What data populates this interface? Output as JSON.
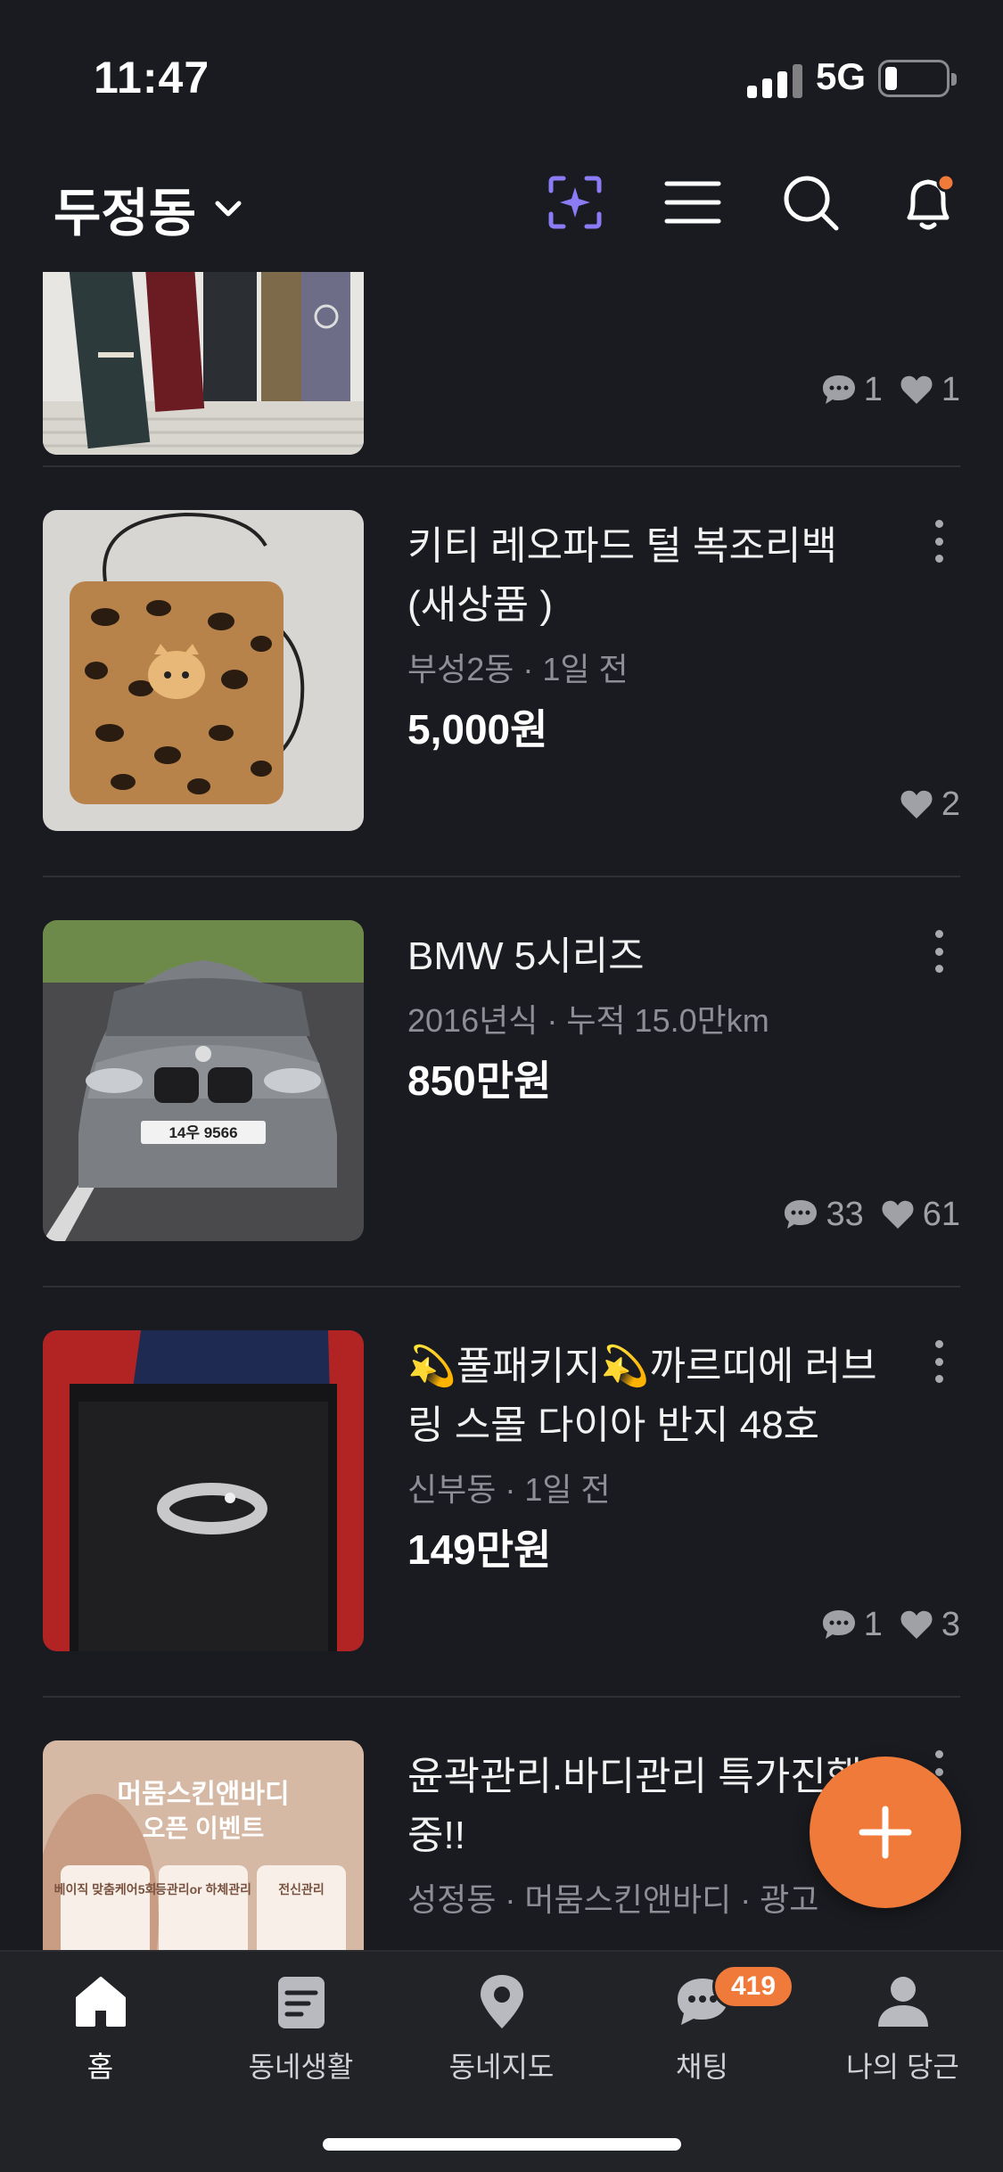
{
  "status_bar": {
    "time": "11:47",
    "network": "5G"
  },
  "header": {
    "location": "두정동"
  },
  "feed": {
    "items": [
      {
        "comments": "1",
        "likes": "1"
      },
      {
        "title": "키티 레오파드 털 복조리백 (새상품 )",
        "meta": "부성2동 · 1일 전",
        "price": "5,000원",
        "likes": "2"
      },
      {
        "title": "BMW 5시리즈",
        "meta": "2016년식 · 누적 15.0만km",
        "price": "850만원",
        "comments": "33",
        "likes": "61",
        "plate": "14우 9566"
      },
      {
        "title": "💫풀패키지💫까르띠에 러브링 스몰 다이아 반지 48호",
        "meta": "신부동 · 1일 전",
        "price": "149만원",
        "comments": "1",
        "likes": "3"
      },
      {
        "title": "윤곽관리.바디관리 특가진행중!!",
        "meta": "성정동 · 머뭄스킨앤바디 · 광고",
        "ad_image": {
          "headline_1": "머뭄스킨앤바디",
          "headline_2": "오픈 이벤트",
          "box_1": "베이직 맞춤케어5회",
          "box_2": "등관리or 하체관리",
          "box_3": "전신관리"
        }
      }
    ]
  },
  "tab_bar": {
    "tabs": [
      {
        "label": "홈",
        "icon": "home-icon"
      },
      {
        "label": "동네생활",
        "icon": "document-icon"
      },
      {
        "label": "동네지도",
        "icon": "map-pin-icon"
      },
      {
        "label": "채팅",
        "icon": "chat-icon",
        "badge": "419"
      },
      {
        "label": "나의 당근",
        "icon": "person-icon"
      }
    ]
  },
  "colors": {
    "accent": "#f07a3a",
    "background": "#1a1b20",
    "tabbar": "#222327"
  }
}
